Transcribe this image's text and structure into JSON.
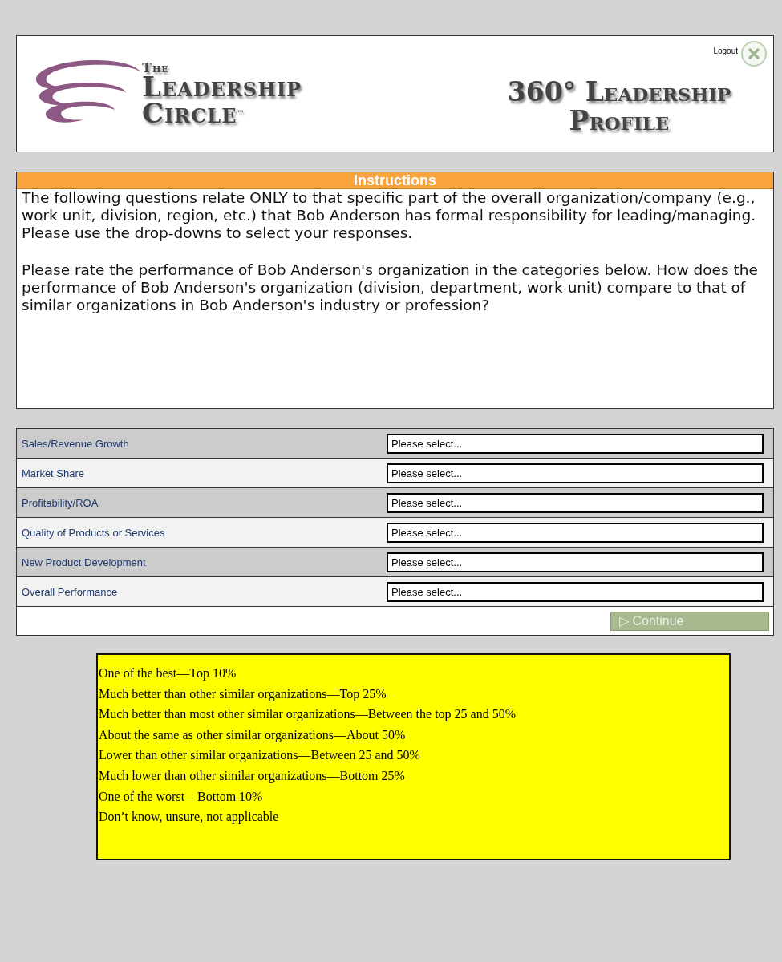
{
  "header": {
    "logo": {
      "line_1": "The",
      "line_2": "Leadership",
      "line_3": "Circle",
      "trademark": "™"
    },
    "title": "360° Leadership Profile",
    "logout": {
      "label": "Logout"
    }
  },
  "instructions": {
    "heading": "Instructions",
    "paragraphs": [
      "The following questions relate ONLY to that specific part of the overall organization/company (e.g., work unit, division, region, etc.) that Bob Anderson has formal responsibility for leading/managing. Please use the drop-downs to select your responses.",
      "Please rate the performance of Bob Anderson's organization in the categories below. How does the performance of Bob Anderson's organization (division, department, work unit) compare to that of similar organizations in Bob Anderson's industry or profession?"
    ]
  },
  "questions": [
    {
      "label": "Sales/Revenue Growth",
      "value": "Please select..."
    },
    {
      "label": "Market Share",
      "value": "Please select..."
    },
    {
      "label": "Profitability/ROA",
      "value": "Please select..."
    },
    {
      "label": "Quality of Products or Services",
      "value": "Please select..."
    },
    {
      "label": "New Product Development",
      "value": "Please select..."
    },
    {
      "label": "Overall Performance",
      "value": "Please select..."
    }
  ],
  "continue_button": {
    "label": "▷ Continue",
    "disabled": true
  },
  "scale_legend": [
    "One of the best—Top 10%",
    "Much better than other similar organizations—Top 25%",
    "Much better than most other similar organizations—Between the top 25 and 50%",
    "About the same as other similar organizations—About 50%",
    "Lower than other similar organizations—Between 25 and 50%",
    "Much lower than other similar organizations—Bottom 25%",
    "One of the worst—Bottom 10%",
    "Don’t know, unsure, not applicable"
  ]
}
